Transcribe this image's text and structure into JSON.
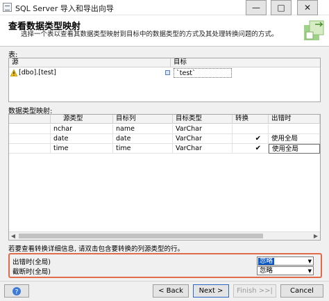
{
  "window": {
    "title": "SQL Server 导入和导出向导",
    "minimize_label": "—",
    "maximize_label": "□",
    "close_label": "✕"
  },
  "header": {
    "title": "查看数据类型映射",
    "description": "选择一个表以查看其数据类型映射到目标中的数据类型的方式及其处理转换问题的方式。"
  },
  "table_section": {
    "label": "表:",
    "columns": {
      "source": "源",
      "destination": "目标"
    },
    "rows": [
      {
        "source": "[dbo].[test]",
        "destination": "`test`",
        "status_icon": "warning-icon"
      }
    ]
  },
  "mapping_section": {
    "label": "数据类型映射:",
    "columns": [
      "源类型",
      "目标列",
      "目标类型",
      "转换",
      "出错时"
    ],
    "rows": [
      {
        "source_type": "nchar",
        "target_column": "name",
        "target_type": "VarChar",
        "convert": false,
        "on_error": ""
      },
      {
        "source_type": "date",
        "target_column": "date",
        "target_type": "VarChar",
        "convert": true,
        "on_error": "使用全局"
      },
      {
        "source_type": "time",
        "target_column": "time",
        "target_type": "VarChar",
        "convert": true,
        "on_error": "使用全局"
      }
    ]
  },
  "info_text": "若要查看转换详细信息, 请双击包含要转换的列源类型的行。",
  "global_settings": {
    "on_error": {
      "label": "出错时(全局)",
      "value": "忽略"
    },
    "on_truncation": {
      "label": "截断时(全局)",
      "value": "忽略"
    }
  },
  "buttons": {
    "back": "< Back",
    "next": "Next >",
    "finish": "Finish >>|",
    "cancel": "Cancel"
  },
  "colors": {
    "highlight_border": "#e06b4b",
    "selection": "#0a58c8"
  }
}
